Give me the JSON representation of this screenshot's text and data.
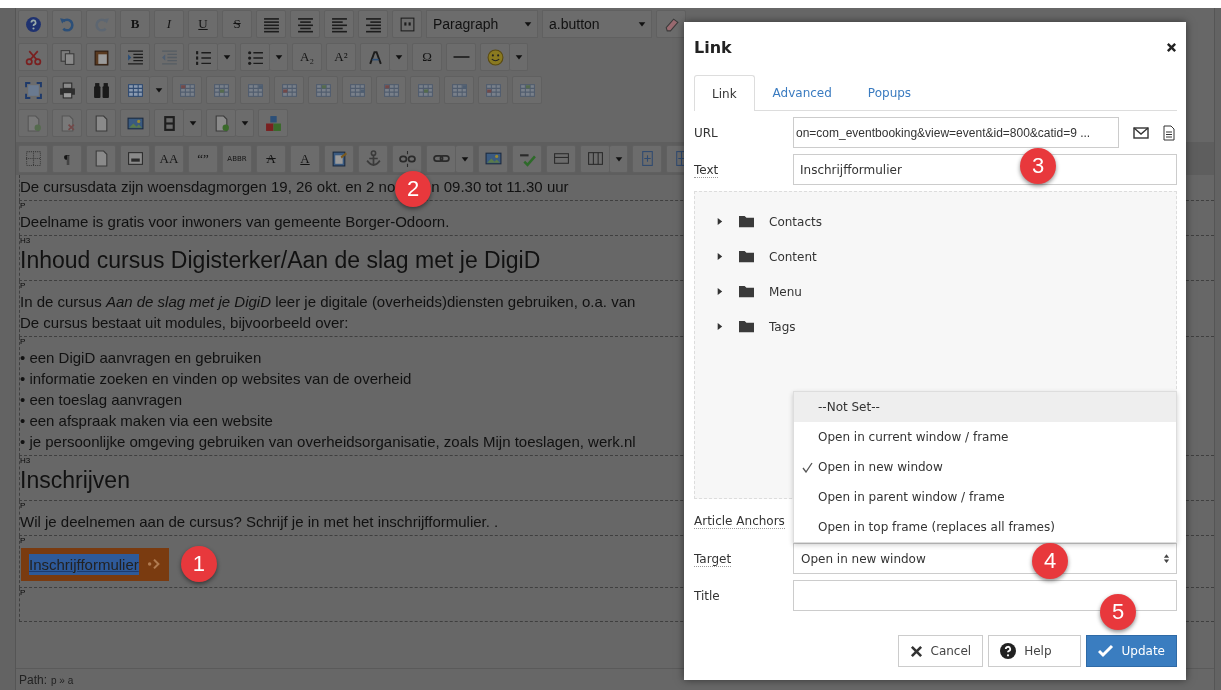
{
  "toolbar": {
    "rows": [
      [
        {
          "kind": "icon",
          "disabled": false
        },
        {
          "kind": "icon",
          "disabled": false
        },
        {
          "kind": "icon",
          "disabled": true
        },
        {
          "kind": "bold",
          "label": "B",
          "disabled": false
        },
        {
          "kind": "italic",
          "label": "I",
          "disabled": false
        },
        {
          "kind": "underline",
          "label": "U",
          "disabled": false
        },
        {
          "kind": "strike",
          "label": "S",
          "disabled": false
        },
        {
          "kind": "icon",
          "disabled": false
        },
        {
          "kind": "icon",
          "disabled": false
        },
        {
          "kind": "icon",
          "disabled": false
        },
        {
          "kind": "icon",
          "disabled": false
        },
        {
          "kind": "icon",
          "disabled": false
        },
        {
          "kind": "select",
          "value": "Paragraph"
        },
        {
          "kind": "select",
          "value": "a.button"
        },
        {
          "kind": "icon",
          "disabled": false
        }
      ],
      [
        {
          "kind": "icon",
          "disabled": false
        },
        {
          "kind": "icon",
          "disabled": false
        },
        {
          "kind": "icon",
          "disabled": false
        },
        {
          "kind": "icon",
          "disabled": false
        },
        {
          "kind": "icon",
          "disabled": true
        },
        {
          "kind": "icon",
          "disabled": false
        },
        {
          "kind": "caret",
          "disabled": false
        },
        {
          "kind": "icon",
          "disabled": false
        },
        {
          "kind": "caret",
          "disabled": false
        },
        {
          "kind": "text",
          "label": "A₂",
          "disabled": false
        },
        {
          "kind": "text",
          "label": "A²",
          "disabled": false
        },
        {
          "kind": "icon",
          "disabled": false
        },
        {
          "kind": "caret",
          "disabled": false
        },
        {
          "kind": "text",
          "label": "Ω",
          "disabled": false
        },
        {
          "kind": "icon",
          "disabled": false
        },
        {
          "kind": "icon",
          "disabled": false
        },
        {
          "kind": "caret",
          "disabled": false
        }
      ],
      [
        {
          "kind": "icon",
          "disabled": false
        },
        {
          "kind": "icon",
          "disabled": false
        },
        {
          "kind": "icon",
          "disabled": false
        },
        {
          "kind": "icon",
          "disabled": false
        },
        {
          "kind": "caret",
          "disabled": false
        },
        {
          "kind": "icon",
          "disabled": true
        },
        {
          "kind": "icon",
          "disabled": true
        },
        {
          "kind": "icon",
          "disabled": true
        },
        {
          "kind": "icon",
          "disabled": true
        },
        {
          "kind": "icon",
          "disabled": true
        },
        {
          "kind": "icon",
          "disabled": true
        },
        {
          "kind": "icon",
          "disabled": true
        },
        {
          "kind": "icon",
          "disabled": true
        },
        {
          "kind": "icon",
          "disabled": true
        },
        {
          "kind": "icon",
          "disabled": true
        },
        {
          "kind": "icon",
          "disabled": true
        }
      ],
      [
        {
          "kind": "icon",
          "disabled": true
        },
        {
          "kind": "icon",
          "disabled": true
        },
        {
          "kind": "icon",
          "disabled": false
        },
        {
          "kind": "icon",
          "disabled": false
        },
        {
          "kind": "icon",
          "disabled": false
        },
        {
          "kind": "caret",
          "disabled": false
        },
        {
          "kind": "icon",
          "disabled": false
        },
        {
          "kind": "caret",
          "disabled": false
        },
        {
          "kind": "icon",
          "disabled": false
        }
      ],
      [
        {
          "kind": "icon",
          "disabled": false
        },
        {
          "kind": "text",
          "label": "¶",
          "disabled": false
        },
        {
          "kind": "icon",
          "disabled": false
        },
        {
          "kind": "icon",
          "disabled": false
        },
        {
          "kind": "text",
          "label": "AA",
          "disabled": false
        },
        {
          "kind": "text",
          "label": "“”",
          "disabled": false
        },
        {
          "kind": "small",
          "label": "ABBR",
          "disabled": false
        },
        {
          "kind": "strike",
          "label": "A",
          "disabled": false
        },
        {
          "kind": "underline",
          "label": "A",
          "disabled": false
        },
        {
          "kind": "icon",
          "disabled": false
        },
        {
          "kind": "icon",
          "disabled": false
        },
        {
          "kind": "icon",
          "disabled": false
        },
        {
          "kind": "icon",
          "disabled": false
        },
        {
          "kind": "caret",
          "disabled": false
        },
        {
          "kind": "icon",
          "disabled": false
        },
        {
          "kind": "icon",
          "disabled": false
        },
        {
          "kind": "icon",
          "disabled": false
        },
        {
          "kind": "icon",
          "disabled": false
        },
        {
          "kind": "caret",
          "disabled": false
        },
        {
          "kind": "icon",
          "disabled": false
        },
        {
          "kind": "icon",
          "disabled": false
        }
      ]
    ]
  },
  "document": {
    "blocks": [
      {
        "kind": "paragraph",
        "lines": [
          [
            "De cursusdata zijn woensdagmorgen 19, 26 okt. en 2 no",
            "n 09.30 tot 11.30 uur"
          ]
        ]
      },
      {
        "kind": "paragraph",
        "tag": "P",
        "lines": [
          [
            "Deelname is gratis voor inwoners van gemeente Borger-Odoorn."
          ]
        ]
      },
      {
        "kind": "heading",
        "tag": "H3",
        "lines": [
          [
            "Inhoud cursus Digisterker/Aan de slag met je DigiD"
          ]
        ]
      },
      {
        "kind": "paragraph",
        "tag": "P",
        "lines": [
          [
            "In de cursus *Aan de slag met je DigiD*  leer je digitale (overheids)diensten gebruiken, o.a. van"
          ],
          [
            "De cursus bestaat uit modules, bijvoorbeeld over:"
          ]
        ]
      },
      {
        "kind": "paragraph",
        "tag": "P",
        "lines": [
          [
            "• een DigiD aanvragen en gebruiken"
          ],
          [
            "• informatie zoeken en vinden op websites van de overheid"
          ],
          [
            "• een toeslag aanvragen"
          ],
          [
            "• een afspraak maken via een website"
          ],
          [
            "• je persoonlijke omgeving gebruiken van overheidsorganisatie, zoals Mijn toeslagen, werk.nl"
          ]
        ]
      },
      {
        "kind": "heading",
        "tag": "H3",
        "lines": [
          [
            "Inschrijven"
          ]
        ]
      },
      {
        "kind": "paragraph",
        "tag": "P",
        "lines": [
          [
            "Wil je deelnemen aan de cursus? Schrijf je in met het inschrijfformulier. ."
          ]
        ]
      },
      {
        "kind": "button",
        "tag": "P",
        "text": "Inschrijfformulier",
        "selected": true
      },
      {
        "kind": "paragraph",
        "tag": "P"
      }
    ]
  },
  "path_bar": {
    "label": "Path:",
    "trail": "p » a"
  },
  "dialog": {
    "title": "Link",
    "tabs": [
      {
        "label": "Link",
        "selected": true
      },
      {
        "label": "Advanced",
        "selected": false
      },
      {
        "label": "Popups",
        "selected": false
      }
    ],
    "fields": [
      {
        "kind": "url",
        "label": "URL",
        "value": "on=com_eventbooking&view=event&id=800&catid=9 ..."
      },
      {
        "kind": "text",
        "label": "Text",
        "value": "Inschrijfformulier"
      }
    ],
    "tree": [
      {
        "label": "Contacts",
        "expanded": false
      },
      {
        "label": "Content",
        "expanded": false
      },
      {
        "label": "Menu",
        "expanded": false
      },
      {
        "label": "Tags",
        "expanded": false
      }
    ],
    "anchors_label": "Article Anchors",
    "target": {
      "label": "Target",
      "value": "Open in new window",
      "options": [
        {
          "label": "--Not Set--",
          "selected": false,
          "highlighted": true
        },
        {
          "label": "Open in current window / frame",
          "selected": false,
          "highlighted": false
        },
        {
          "label": "Open in new window",
          "selected": true,
          "highlighted": false
        },
        {
          "label": "Open in parent window / frame",
          "selected": false,
          "highlighted": false
        },
        {
          "label": "Open in top frame (replaces all frames)",
          "selected": false,
          "highlighted": false
        }
      ]
    },
    "title_field": {
      "label": "Title"
    },
    "buttons": [
      {
        "kind": "cancel",
        "label": "Cancel"
      },
      {
        "kind": "help",
        "label": "Help"
      },
      {
        "kind": "primary",
        "label": "Update"
      }
    ]
  },
  "callouts": [
    "1",
    "2",
    "3",
    "4",
    "5"
  ]
}
